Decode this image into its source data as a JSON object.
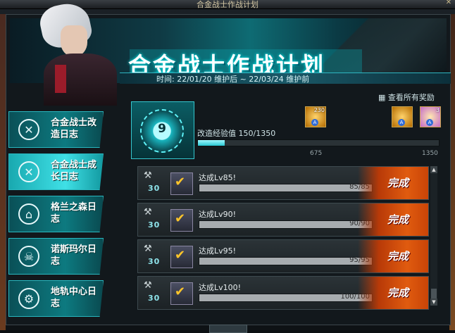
{
  "window": {
    "title": "合金战士作战计划"
  },
  "banner": {
    "title": "合金战士作战计划",
    "time": "时间: 22/01/20 维护后 ~ 22/03/24 维护前"
  },
  "sidebar": {
    "items": [
      {
        "label": "合金战士改造日志",
        "active": false
      },
      {
        "label": "合金战士成长日志",
        "active": true
      },
      {
        "label": "格兰之森日志",
        "active": false
      },
      {
        "label": "诺斯玛尔日志",
        "active": false
      },
      {
        "label": "地轨中心日志",
        "active": false
      }
    ]
  },
  "level": {
    "value": "9"
  },
  "rewards": {
    "view_all": "查看所有奖励",
    "item1_count": "230",
    "item3_count": "3",
    "badge": "A"
  },
  "experience": {
    "label": "改造经验值",
    "value": "150/1350",
    "current": 150,
    "max": 1350,
    "marker1": "675",
    "marker2": "1350"
  },
  "missions": [
    {
      "points": "30",
      "name": "达成Lv85!",
      "progress": "85/85",
      "action": "完成"
    },
    {
      "points": "30",
      "name": "达成Lv90!",
      "progress": "90/90",
      "action": "完成"
    },
    {
      "points": "30",
      "name": "达成Lv95!",
      "progress": "95/95",
      "action": "完成"
    },
    {
      "points": "30",
      "name": "达成Lv100!",
      "progress": "100/100",
      "action": "完成"
    }
  ]
}
